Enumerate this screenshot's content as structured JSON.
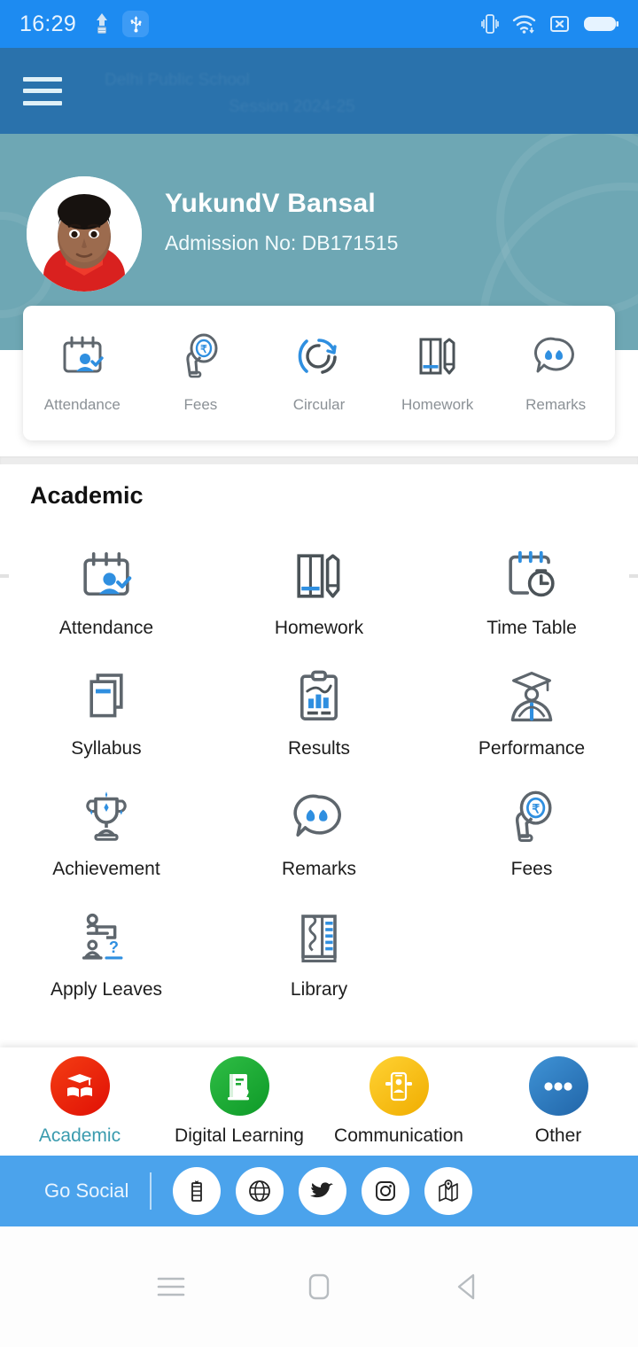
{
  "statusbar": {
    "time": "16:29",
    "icons": [
      "app-notification-icon",
      "usb-icon",
      "vibrate-icon",
      "wifi-icon",
      "sim-card-icon",
      "battery-icon"
    ]
  },
  "appbar": {
    "menu_icon": "hamburger-menu-icon",
    "ghost_line_1": "Delhi Public School",
    "ghost_line_2": "Session 2024-25"
  },
  "profile": {
    "name": "YukundV Bansal",
    "admission_label": "Admission No: DB171515",
    "avatar_alt": "student-photo"
  },
  "quick_actions": [
    {
      "label": "Attendance",
      "icon": "attendance-calendar-icon"
    },
    {
      "label": "Fees",
      "icon": "fees-rupee-icon"
    },
    {
      "label": "Circular",
      "icon": "circular-refresh-icon"
    },
    {
      "label": "Homework",
      "icon": "homework-book-pencil-icon"
    },
    {
      "label": "Remarks",
      "icon": "remarks-quote-bubble-icon"
    }
  ],
  "academic": {
    "title": "Academic",
    "items": [
      {
        "label": "Attendance",
        "icon": "attendance-calendar-icon"
      },
      {
        "label": "Homework",
        "icon": "homework-book-pencil-icon"
      },
      {
        "label": "Time Table",
        "icon": "timetable-clock-icon"
      },
      {
        "label": "Syllabus",
        "icon": "syllabus-documents-icon"
      },
      {
        "label": "Results",
        "icon": "results-clipboard-chart-icon"
      },
      {
        "label": "Performance",
        "icon": "performance-graduate-icon"
      },
      {
        "label": "Achievement",
        "icon": "achievement-trophy-icon"
      },
      {
        "label": "Remarks",
        "icon": "remarks-quote-bubble-icon"
      },
      {
        "label": "Fees",
        "icon": "fees-rupee-icon"
      },
      {
        "label": "Apply Leaves",
        "icon": "apply-leaves-icon"
      },
      {
        "label": "Library",
        "icon": "library-books-icon"
      }
    ]
  },
  "bottom_nav": {
    "active": "Academic",
    "items": [
      {
        "label": "Academic",
        "icon": "graduation-book-icon",
        "color": "#f03010"
      },
      {
        "label": "Digital Learning",
        "icon": "digital-book-icon",
        "color": "#1faa35"
      },
      {
        "label": "Communication",
        "icon": "mobile-chat-icon",
        "color": "#f7c10e"
      },
      {
        "label": "Other",
        "icon": "more-dots-icon",
        "color": "#2f7fc4"
      }
    ]
  },
  "go_social": {
    "label": "Go Social",
    "icons": [
      "facebook-icon",
      "website-globe-icon",
      "twitter-icon",
      "instagram-icon",
      "map-location-icon"
    ]
  },
  "android_nav": {
    "buttons": [
      "recents-icon",
      "home-icon",
      "back-icon"
    ]
  },
  "colors": {
    "status_bar": "#1d8bf1",
    "app_bar": "#2a72ac",
    "banner": "#6ea7b4",
    "social_bar": "#4ba3ec",
    "accent_blue": "#2f8fe0",
    "active_tab": "#3a9bae",
    "icon_grey": "#60676d"
  }
}
